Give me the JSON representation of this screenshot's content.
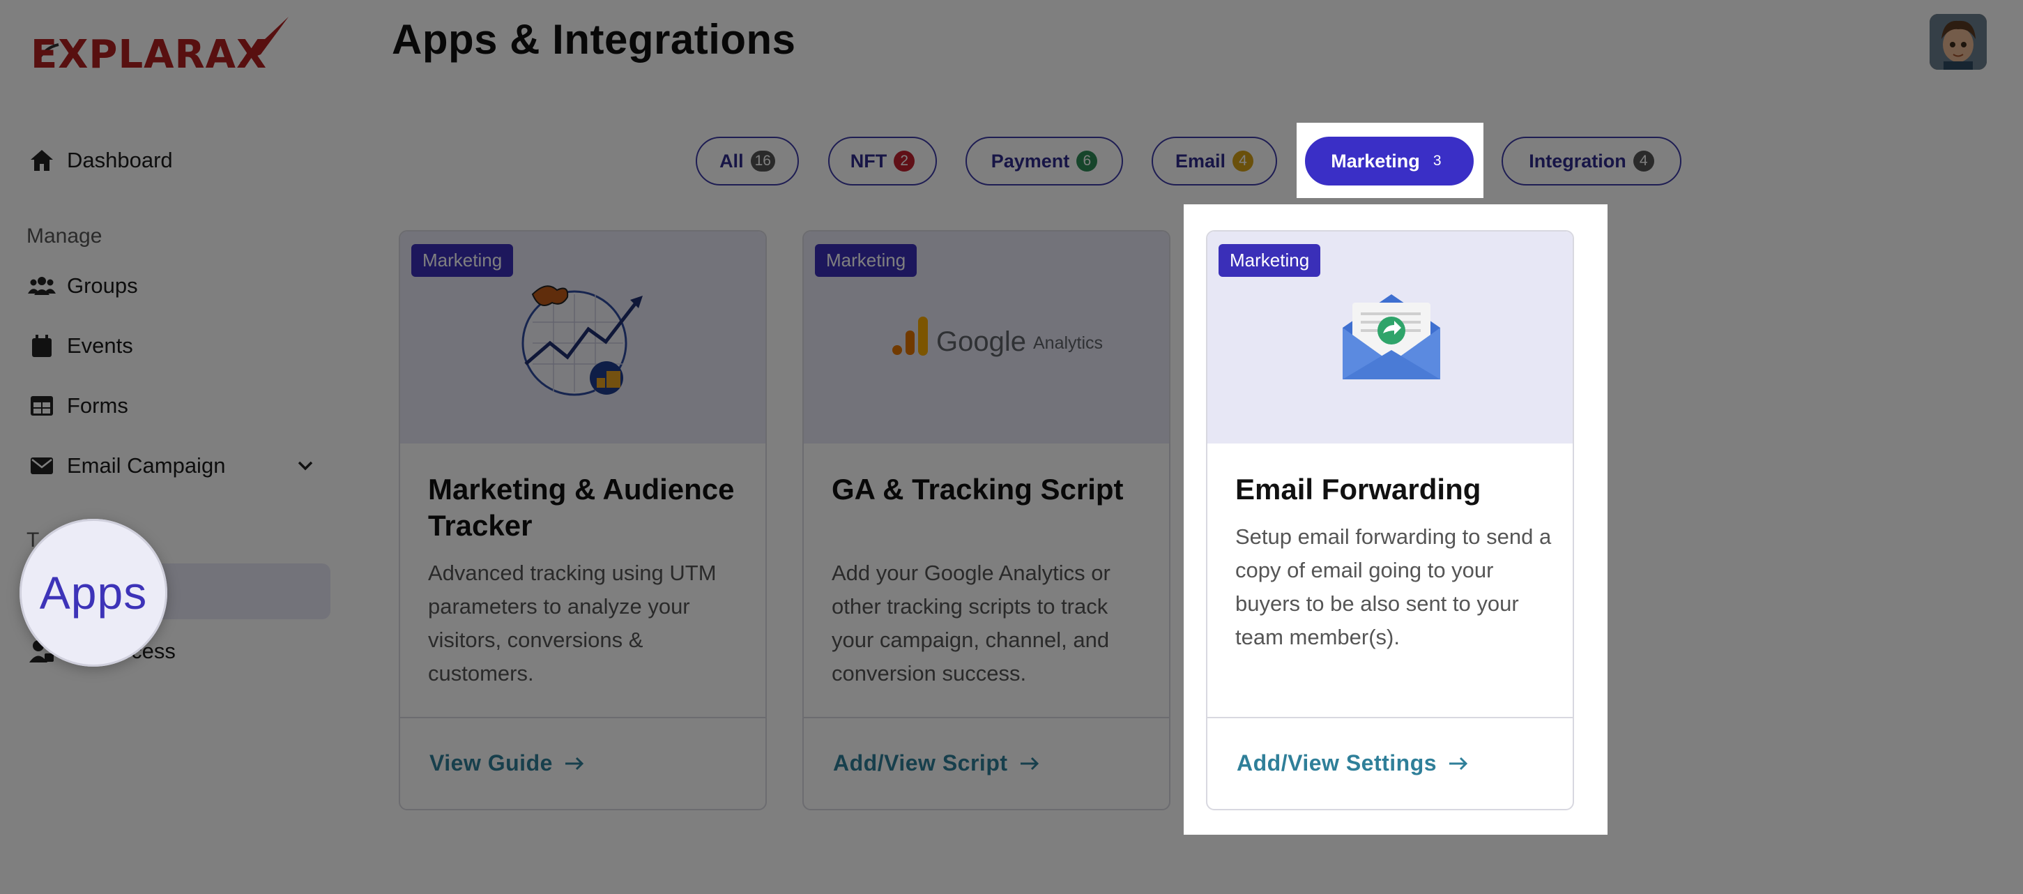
{
  "brand": {
    "logo_text": "EXPLARAX",
    "accent": "#b02020"
  },
  "header": {
    "title": "Apps & Integrations"
  },
  "sidebar": {
    "items": [
      {
        "label": "Dashboard",
        "icon": "home-icon"
      },
      {
        "label": "Groups",
        "icon": "users-icon"
      },
      {
        "label": "Events",
        "icon": "calendar-icon"
      },
      {
        "label": "Forms",
        "icon": "table-icon"
      },
      {
        "label": "Email Campaign",
        "icon": "envelope-icon"
      },
      {
        "label": "Access",
        "icon": "user-lock-icon"
      }
    ],
    "section_manage": "Manage",
    "section_partial": "T",
    "magnifier_label": "Apps"
  },
  "filters": [
    {
      "label": "All",
      "count": "16",
      "count_color": "#555555"
    },
    {
      "label": "NFT",
      "count": "2",
      "count_color": "#c0202e"
    },
    {
      "label": "Payment",
      "count": "6",
      "count_color": "#2e8b57"
    },
    {
      "label": "Email",
      "count": "4",
      "count_color": "#d4a017"
    },
    {
      "label": "Marketing",
      "count": "3",
      "count_color": "#3a2fc6"
    },
    {
      "label": "Integration",
      "count": "4",
      "count_color": "#555555"
    }
  ],
  "cards": [
    {
      "tag": "Marketing",
      "title": "Marketing & Audience Tracker",
      "description": "Advanced tracking using UTM parameters to analyze your visitors, conversions & customers.",
      "action": "View Guide",
      "illustration": "analytics-chart-icon"
    },
    {
      "tag": "Marketing",
      "title": "GA & Tracking Script",
      "description": "Add your Google Analytics or other tracking scripts to track your campaign, channel, and conversion success.",
      "action": "Add/View Script",
      "illustration": "google-analytics-logo",
      "logo_word": "Google",
      "logo_sub": "Analytics"
    },
    {
      "tag": "Marketing",
      "title": "Email Forwarding",
      "description": "Setup email forwarding to send a copy of email going to your buyers to be also sent to your team member(s).",
      "action": "Add/View Settings",
      "illustration": "email-forward-icon"
    }
  ]
}
